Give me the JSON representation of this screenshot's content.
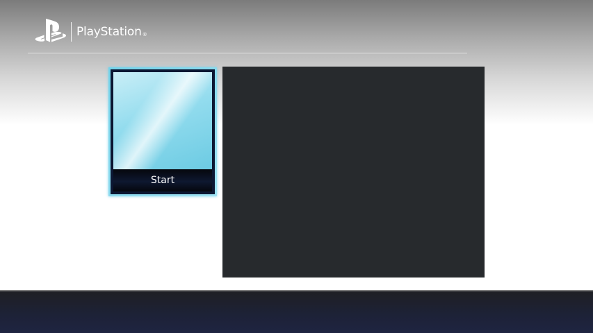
{
  "header": {
    "brand_name": "PlayStation",
    "brand_mark": "®",
    "logo_icon": "playstation-logo-icon"
  },
  "tiles": [
    {
      "label": "Start",
      "selected": true
    }
  ],
  "colors": {
    "selection_border": "#74d3ea",
    "preview_panel": "#272a2d",
    "footer": "#1f2441"
  }
}
